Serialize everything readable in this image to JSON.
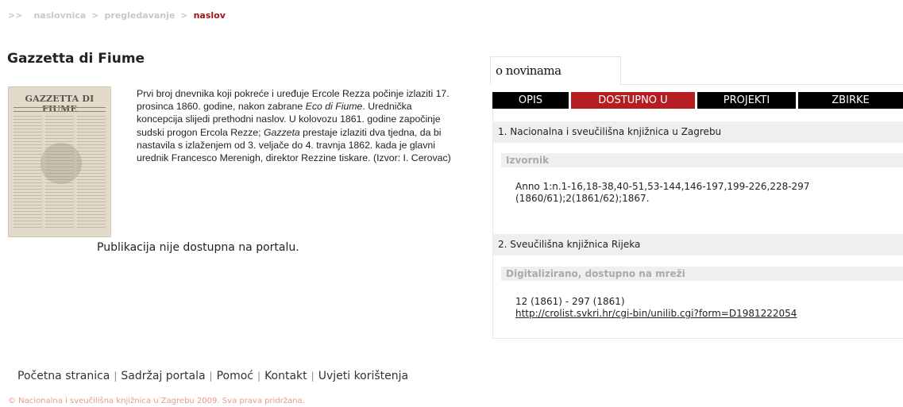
{
  "breadcrumb": {
    "prefix": ">>",
    "items": [
      "naslovnica",
      "pregledavanje"
    ],
    "separator": ">",
    "current": "naslov"
  },
  "publication": {
    "title": "Gazzetta di Fiume",
    "thumbnail_masthead": "GAZZETTA DI FIUME",
    "description": {
      "p1": "Prvi broj dnevnika koji pokreće i uređuje Ercole Rezza počinje izlaziti 17. prosinca 1860. godine, nakon zabrane ",
      "i1": "Eco di Fiume",
      "p2": ". Urednička koncepcija slijedi prethodni naslov. U kolovozu 1861. godine započinje sudski progon Ercola Rezze; ",
      "i2": "Gazzeta",
      "p3": " prestaje izlaziti dva tjedna, da bi nastavila s izlaženjem od 3. veljače do 4. travnja 1862. kada je glavni urednik Francesco Merenigh, direktor Rezzine tiskare. (Izvor: I. Cerovac)"
    },
    "notice": "Publikacija nije dostupna na portalu."
  },
  "panel": {
    "heading": "o novinama",
    "tabs": [
      "OPIS",
      "DOSTUPNO U",
      "PROJEKTI",
      "ZBIRKE"
    ],
    "active_tab": "DOSTUPNO U",
    "libraries": [
      {
        "name": "1. Nacionalna i sveučilišna knjižnica u Zagrebu",
        "type": "Izvornik",
        "holdings": "Anno 1:n.1-16,18-38,40-51,53-144,146-197,199-226,228-297 (1860/61);2(1861/62);1867.",
        "link": ""
      },
      {
        "name": "2. Sveučilišna knjižnica Rijeka",
        "type": "Digitalizirano, dostupno na mreži",
        "holdings": "12 (1861) - 297 (1861)",
        "link": "http://crolist.svkri.hr/cgi-bin/unilib.cgi?form=D1981222054"
      }
    ]
  },
  "footer": {
    "links": [
      "Početna stranica",
      "Sadržaj portala",
      "Pomoć",
      "Kontakt",
      "Uvjeti korištenja"
    ],
    "separator": "|",
    "copyright": "© Nacionalna i sveučilišna knjižnica u Zagrebu 2009. Sva prava pridržana."
  },
  "colors": {
    "accent_red": "#b41e23",
    "breadcrumb_current": "#a01414",
    "copyright": "#e89a88"
  }
}
